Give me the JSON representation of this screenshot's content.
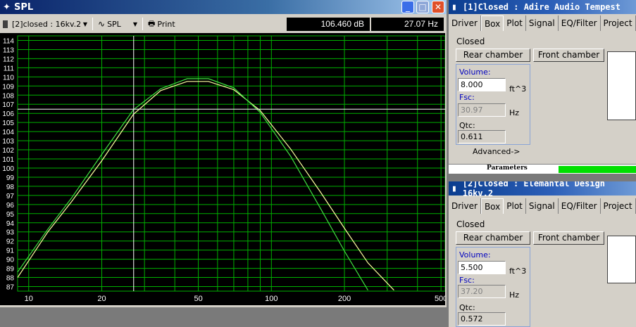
{
  "spl": {
    "title": "SPL",
    "dropdown": "[2]closed : 16kv.2",
    "spl_label": "SPL",
    "print_label": "Print",
    "readout_db": "106.460 dB",
    "readout_hz": "27.07 Hz",
    "y_ticks": [
      "114",
      "113",
      "112",
      "111",
      "110",
      "109",
      "108",
      "107",
      "106",
      "105",
      "104",
      "103",
      "102",
      "101",
      "100",
      "99",
      "98",
      "97",
      "96",
      "95",
      "94",
      "93",
      "92",
      "91",
      "90",
      "89",
      "88",
      "87"
    ],
    "x_ticks": [
      "10",
      "20",
      "50",
      "100",
      "200",
      "500"
    ],
    "colors": {
      "grid": "#00b000",
      "curve1": "#ffffa0",
      "curve2": "#40e040",
      "background": "#000000"
    }
  },
  "chart_data": {
    "type": "line",
    "xlim": [
      9,
      520
    ],
    "ylim": [
      86.5,
      114.5
    ],
    "x_scale": "log",
    "cursor": {
      "x": 27.07,
      "y": 106.46
    },
    "series": [
      {
        "color": "#ffffa0",
        "x": [
          9,
          12,
          15,
          20,
          27,
          35,
          45,
          55,
          70,
          90,
          120,
          160,
          200,
          250,
          320
        ],
        "y": [
          88,
          93,
          96.3,
          100.8,
          105.9,
          108.5,
          109.5,
          109.5,
          108.6,
          106.3,
          102.1,
          97.3,
          93.4,
          89.6,
          86.6
        ]
      },
      {
        "color": "#40e040",
        "x": [
          9,
          12,
          15,
          20,
          27,
          35,
          45,
          55,
          70,
          90,
          120,
          160,
          200,
          250
        ],
        "y": [
          88.6,
          93.3,
          96.7,
          101.5,
          106.4,
          108.7,
          109.8,
          109.8,
          108.8,
          106.1,
          101.3,
          95.5,
          90.9,
          86.6
        ]
      }
    ]
  },
  "tempest": {
    "title": "[1]Closed : Adire Audio Tempest",
    "tabs": [
      "Driver",
      "Box",
      "Plot",
      "Signal",
      "EQ/Filter",
      "Project"
    ],
    "type": "Closed",
    "rear_btn": "Rear chamber",
    "front_btn": "Front chamber",
    "volume_label": "Volume:",
    "volume_value": "8.000",
    "volume_unit": "ft^3",
    "fsc_label": "Fsc:",
    "fsc_value": "30.97",
    "fsc_unit": "Hz",
    "qtc_label": "Qtc:",
    "qtc_value": "0.611",
    "advanced": "Advanced->",
    "status": "Parameters",
    "status_color": "#00e000"
  },
  "sixteen": {
    "title": "[2]Closed : Elemantal Design 16kv.2",
    "tabs": [
      "Driver",
      "Box",
      "Plot",
      "Signal",
      "EQ/Filter",
      "Project"
    ],
    "type": "Closed",
    "rear_btn": "Rear chamber",
    "front_btn": "Front chamber",
    "volume_label": "Volume:",
    "volume_value": "5.500",
    "volume_unit": "ft^3",
    "fsc_label": "Fsc:",
    "fsc_value": "37.20",
    "fsc_unit": "Hz",
    "qtc_label": "Qtc:",
    "qtc_value": "0.572"
  }
}
